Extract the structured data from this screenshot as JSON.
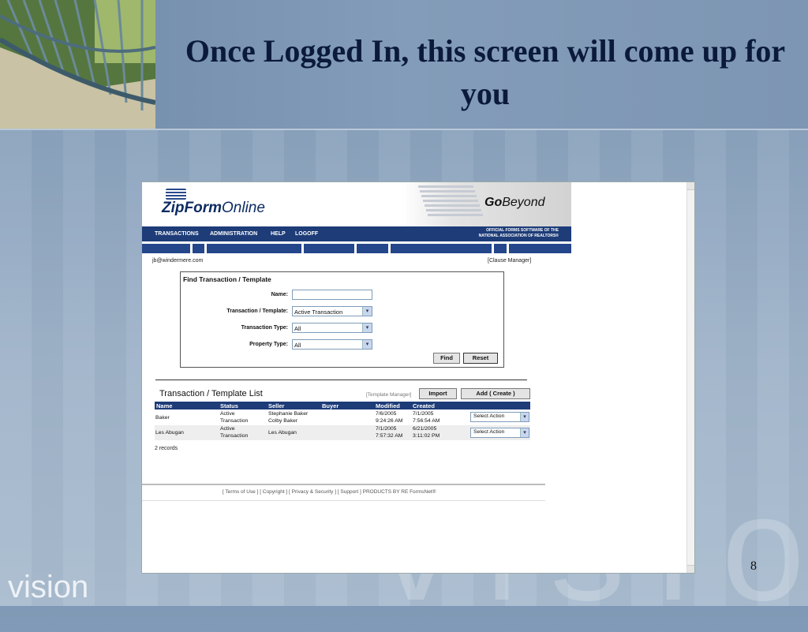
{
  "slide": {
    "title": "Once Logged In, this screen will come up for you",
    "page_number": "8",
    "logo_text": "vision",
    "watermark_text": "vision"
  },
  "app": {
    "logo_main": "ZipForm",
    "logo_sub": "Online",
    "tagline_go": "Go",
    "tagline_beyond": "Beyond",
    "nav": {
      "transactions": "TRANSACTIONS",
      "administration": "ADMINISTRATION",
      "help": "HELP",
      "logoff": "LOGOFF",
      "official_line1": "OFFICIAL FORMS SOFTWARE OF THE",
      "official_line2": "NATIONAL ASSOCIATION OF REALTORS®"
    },
    "user_email": "jb@windermere.com",
    "clause_manager": "[Clause Manager]",
    "find": {
      "title": "Find Transaction / Template",
      "name_label": "Name:",
      "name_value": "",
      "tt_label": "Transaction / Template:",
      "tt_value": "Active Transaction",
      "type_label": "Transaction Type:",
      "type_value": "All",
      "prop_label": "Property Type:",
      "prop_value": "All",
      "find_btn": "Find",
      "reset_btn": "Reset"
    },
    "list": {
      "title": "Transaction  /  Template  List",
      "template_manager": "[Template Manager]",
      "import_btn": "Import",
      "add_btn": "Add ( Create )",
      "headers": [
        "Name",
        "Status",
        "Seller",
        "Buyer",
        "Modified",
        "Created"
      ],
      "rows": [
        {
          "name": "Baker",
          "status1": "Active",
          "status2": "Transaction",
          "seller1": "Stephanie Baker",
          "seller2": "Colby Baker",
          "buyer": "",
          "modified1": "7/6/2005",
          "modified2": "9:24:26 AM",
          "created1": "7/1/2005",
          "created2": "7:56:54 AM",
          "action": "Select Action"
        },
        {
          "name": "Les Abugan",
          "status1": "Active",
          "status2": "Transaction",
          "seller1": "Les Abugan",
          "seller2": "",
          "buyer": "",
          "modified1": "7/1/2005",
          "modified2": "7:57:32 AM",
          "created1": "6/21/2005",
          "created2": "3:11:02 PM",
          "action": "Select Action"
        }
      ],
      "record_count": "2 records"
    },
    "footer": "[ Terms of Use ]  [ Copyright ]  [ Privacy & Security ]  [ Support ]  PRODUCTS BY RE FormsNet®"
  },
  "colors": {
    "nav_blue": "#1d3c78",
    "slide_bg": "#8fa6c0",
    "title_color": "#0b1a3a"
  }
}
